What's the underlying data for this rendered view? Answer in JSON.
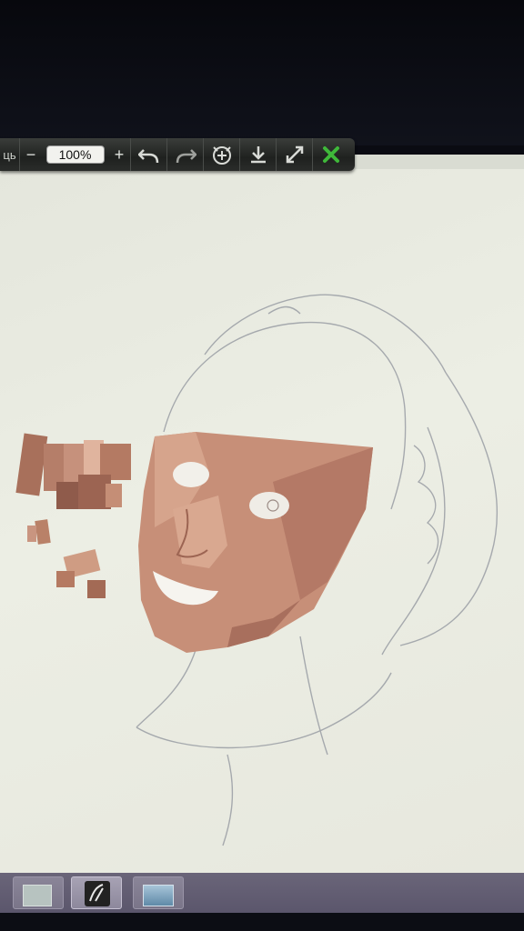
{
  "toolbar": {
    "partial_label": "ць",
    "zoom_out_label": "−",
    "zoom_value": "100%",
    "zoom_in_label": "+",
    "icons": [
      "undo-icon",
      "redo-icon",
      "rotate-icon",
      "save-icon",
      "expand-icon",
      "close-icon"
    ]
  },
  "taskbar": {
    "items": [
      "window-thumbnail",
      "sketch-app-icon",
      "image-thumbnail"
    ]
  }
}
